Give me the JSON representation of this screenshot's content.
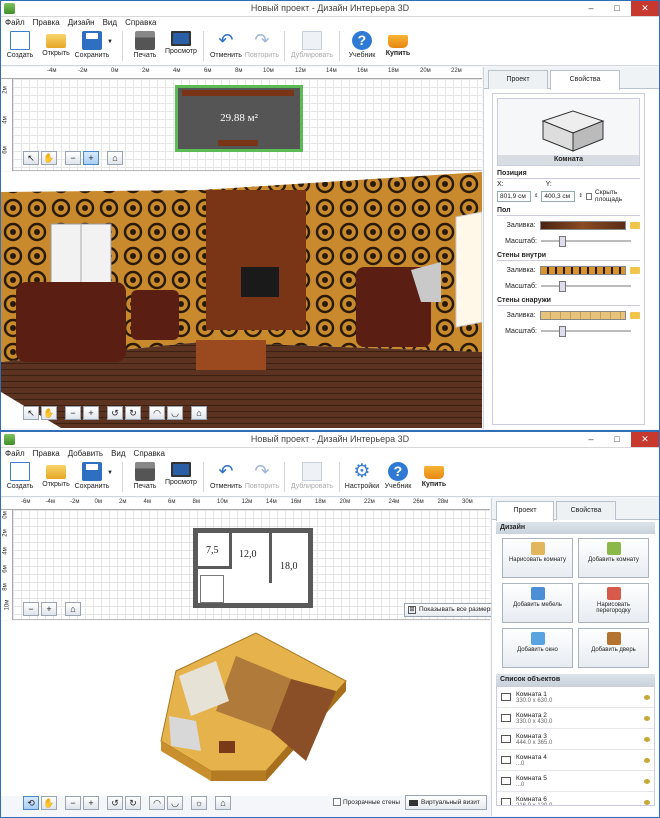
{
  "window1": {
    "title": "Новый проект - Дизайн Интерьера 3D",
    "menu": [
      "Файл",
      "Правка",
      "Дизайн",
      "Вид",
      "Справка"
    ],
    "toolbar": [
      {
        "label": "Создать",
        "icon": "new-document-icon"
      },
      {
        "label": "Открыть",
        "icon": "open-folder-icon"
      },
      {
        "label": "Сохранить",
        "icon": "save-icon"
      },
      {
        "label": "Печать",
        "icon": "printer-icon"
      },
      {
        "label": "Просмотр",
        "icon": "monitor-icon"
      },
      {
        "label": "Отменить",
        "icon": "undo-icon"
      },
      {
        "label": "Повторить",
        "icon": "redo-icon"
      },
      {
        "label": "Дублировать",
        "icon": "duplicate-icon"
      },
      {
        "label": "Учебник",
        "icon": "help-icon"
      },
      {
        "label": "Купить",
        "icon": "cart-icon"
      }
    ],
    "ruler_labels": [
      "0м",
      "2м",
      "4м",
      "6м",
      "8м",
      "10м",
      "12м",
      "14м",
      "16м",
      "18м",
      "20м",
      "22м"
    ],
    "ruler_neg": [
      "-4м",
      "-2м"
    ],
    "vruler_labels": [
      "2м",
      "4м",
      "6м"
    ],
    "room_area": "29.88 м²",
    "tabs": {
      "project": "Проект",
      "properties": "Свойства"
    },
    "preview_caption": "Комната",
    "position": {
      "heading": "Позиция",
      "x_label": "X:",
      "y_label": "Y:",
      "x_value": "801,9 см",
      "y_value": "400,3 см",
      "hide_area": "Скрыть площадь"
    },
    "floor": {
      "heading": "Пол",
      "fill": "Заливка:",
      "scale": "Масштаб:",
      "color": "#6b3a1c"
    },
    "walls_in": {
      "heading": "Стены внутри",
      "fill": "Заливка:",
      "scale": "Масштаб:",
      "color": "#d9952d"
    },
    "walls_out": {
      "heading": "Стены снаружи",
      "fill": "Заливка:",
      "scale": "Масштаб:",
      "color": "#e7c27a"
    }
  },
  "window2": {
    "title": "Новый проект - Дизайн Интерьера 3D",
    "menu": [
      "Файл",
      "Правка",
      "Добавить",
      "Вид",
      "Справка"
    ],
    "toolbar": [
      {
        "label": "Создать",
        "icon": "new-document-icon"
      },
      {
        "label": "Открыть",
        "icon": "open-folder-icon"
      },
      {
        "label": "Сохранить",
        "icon": "save-icon"
      },
      {
        "label": "Печать",
        "icon": "printer-icon"
      },
      {
        "label": "Просмотр",
        "icon": "monitor-icon"
      },
      {
        "label": "Отменить",
        "icon": "undo-icon"
      },
      {
        "label": "Повторить",
        "icon": "redo-icon"
      },
      {
        "label": "Дублировать",
        "icon": "duplicate-icon"
      },
      {
        "label": "Настройки",
        "icon": "gear-icon"
      },
      {
        "label": "Учебник",
        "icon": "help-icon"
      },
      {
        "label": "Купить",
        "icon": "cart-icon"
      }
    ],
    "ruler_labels": [
      "-6м",
      "-4м",
      "-2м",
      "0м",
      "2м",
      "4м",
      "6м",
      "8м",
      "10м",
      "12м",
      "14м",
      "16м",
      "18м",
      "20м",
      "22м",
      "24м",
      "26м",
      "28м",
      "30м"
    ],
    "vruler_labels": [
      "0м",
      "2м",
      "4м",
      "6м",
      "8м",
      "10м"
    ],
    "room_labels": [
      "7,5",
      "12,0",
      "18,0"
    ],
    "show_all_sizes": "Показывать все размеры",
    "tabs": {
      "project": "Проект",
      "properties": "Свойства"
    },
    "design_heading": "Дизайн",
    "design_buttons": [
      {
        "label": "Нарисовать комнату",
        "icon": "draw-room-icon",
        "color": "#e1b65c"
      },
      {
        "label": "Добавить комнату",
        "icon": "add-room-icon",
        "color": "#8bb84a"
      },
      {
        "label": "Добавить мебель",
        "icon": "add-furniture-icon",
        "color": "#4c8fd6"
      },
      {
        "label": "Нарисовать перегородку",
        "icon": "draw-partition-icon",
        "color": "#d85a4a"
      },
      {
        "label": "Добавить окно",
        "icon": "add-window-icon",
        "color": "#58a3e0"
      },
      {
        "label": "Добавить дверь",
        "icon": "add-door-icon",
        "color": "#b4742f"
      }
    ],
    "objects_heading": "Список объектов",
    "objects": [
      {
        "name": "Комната 1",
        "size": "330.0 x 630.0"
      },
      {
        "name": "Комната 2",
        "size": "330.0 x 430.0"
      },
      {
        "name": "Комната 3",
        "size": "444.0 x 365.0"
      },
      {
        "name": "Комната 4",
        "size": "...0"
      },
      {
        "name": "Комната 5",
        "size": "...0"
      },
      {
        "name": "Комната 6",
        "size": "216.0 x 120.0"
      }
    ],
    "transparent_walls": "Прозрачные стены",
    "virtual_visit": "Виртуальный визит"
  }
}
